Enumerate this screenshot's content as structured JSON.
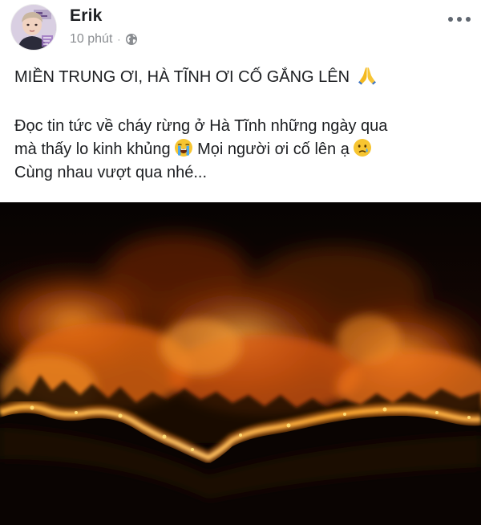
{
  "post": {
    "author": "Erik",
    "time": "10 phút",
    "separator": "·",
    "privacy_icon": "globe-icon",
    "more_icon": "more-options-icon",
    "headline": "MIỀN TRUNG ƠI, HÀ TĨNH ƠI CỐ GẮNG LÊN",
    "headline_emoji": "folded-hands-emoji",
    "body_line1": "Đọc tin tức về cháy rừng ở Hà Tĩnh những ngày qua",
    "body_line2_a": "mà thấy lo kinh khủng",
    "body_line2_emoji": "loudly-crying-face-emoji",
    "body_line2_b": "Mọi người ơi cố lên ạ",
    "body_line2_emoji2": "crying-face-emoji",
    "body_line3": "Cùng nhau vượt qua nhé...",
    "photo_subject": "forest fire at night"
  },
  "colors": {
    "text": "#1c1e21",
    "meta": "#8a8d91",
    "fire_bright": "#ffe27a",
    "fire_orange": "#ff7a12",
    "smoke": "#3a1a08"
  }
}
